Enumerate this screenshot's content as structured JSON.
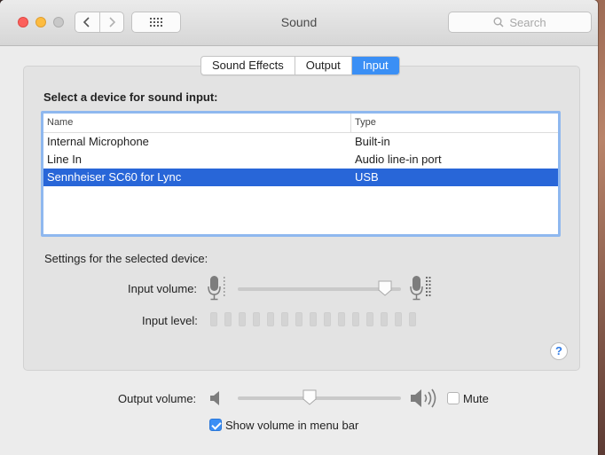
{
  "window": {
    "title": "Sound"
  },
  "toolbar": {
    "back_icon": "chevron-left-icon",
    "forward_icon": "chevron-right-icon",
    "grid_icon": "grid-icon",
    "search_placeholder": "Search"
  },
  "tabs": [
    {
      "label": "Sound Effects",
      "active": false
    },
    {
      "label": "Output",
      "active": false
    },
    {
      "label": "Input",
      "active": true
    }
  ],
  "input": {
    "section_title": "Select a device for sound input:",
    "columns": {
      "name": "Name",
      "type": "Type"
    },
    "devices": [
      {
        "name": "Internal Microphone",
        "type": "Built-in",
        "selected": false
      },
      {
        "name": "Line In",
        "type": "Audio line-in port",
        "selected": false
      },
      {
        "name": "Sennheiser SC60 for Lync",
        "type": "USB",
        "selected": true
      }
    ],
    "settings_label": "Settings for the selected device:",
    "volume_label": "Input volume:",
    "volume_fraction": 0.9,
    "level_label": "Input level:",
    "level_cell_count": 15,
    "level_active": 0
  },
  "output": {
    "volume_label": "Output volume:",
    "volume_fraction": 0.44,
    "mute_label": "Mute",
    "muted": false,
    "menubar_label": "Show volume in menu bar",
    "menubar_checked": true
  },
  "colors": {
    "accent": "#3a8ff5",
    "selection": "#2866d8",
    "table_focus_ring": "#8fb8ef"
  }
}
